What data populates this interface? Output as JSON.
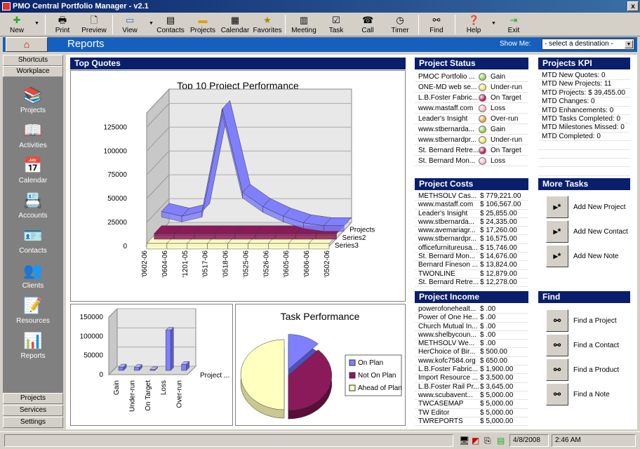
{
  "window": {
    "title": "PMO Central Portfolio Manager - v2.1",
    "close_label": "x"
  },
  "toolbar": [
    {
      "label": "New",
      "icon": "plus-icon"
    },
    {
      "label": "Print",
      "icon": "printer-icon"
    },
    {
      "label": "Preview",
      "icon": "preview-icon"
    },
    {
      "label": "View",
      "icon": "view-icon"
    },
    {
      "label": "Contacts",
      "icon": "contacts-icon"
    },
    {
      "label": "Projects",
      "icon": "folder-icon"
    },
    {
      "label": "Calendar",
      "icon": "calendar-icon"
    },
    {
      "label": "Favorites",
      "icon": "star-icon"
    },
    {
      "label": "Meeting",
      "icon": "meeting-icon"
    },
    {
      "label": "Task",
      "icon": "checkbox-icon"
    },
    {
      "label": "Call",
      "icon": "phone-icon"
    },
    {
      "label": "Timer",
      "icon": "clock-icon"
    },
    {
      "label": "Find",
      "icon": "binoculars-icon"
    },
    {
      "label": "Help",
      "icon": "help-icon"
    },
    {
      "label": "Exit",
      "icon": "exit-icon"
    }
  ],
  "header": {
    "title": "Reports",
    "show_me_label": "Show Me:",
    "destination_value": "- select a destination -"
  },
  "sidebar": {
    "top_tabs": [
      "Shortcuts",
      "Workplace"
    ],
    "items": [
      {
        "label": "Projects",
        "icon": "books-icon"
      },
      {
        "label": "Activities",
        "icon": "activities-icon"
      },
      {
        "label": "Calendar",
        "icon": "calendar-icon"
      },
      {
        "label": "Accounts",
        "icon": "accounts-icon"
      },
      {
        "label": "Contacts",
        "icon": "contact-card-icon"
      },
      {
        "label": "Clients",
        "icon": "clients-icon"
      },
      {
        "label": "Resources",
        "icon": "resources-icon"
      },
      {
        "label": "Reports",
        "icon": "reports-icon"
      }
    ],
    "bottom_tabs": [
      "Projects",
      "Services",
      "Settings"
    ]
  },
  "top_quotes": {
    "title": "Top Quotes"
  },
  "project_status": {
    "title": "Project Status",
    "rows": [
      {
        "name": "PMOC Portfolio ...",
        "status": "Gain",
        "color": "#8fd14f"
      },
      {
        "name": "ONE-MD web se...",
        "status": "Under-run",
        "color": "#f0e060"
      },
      {
        "name": "L.B.Foster Fabric...",
        "status": "On Target",
        "color": "#c0185c"
      },
      {
        "name": "www.mastaff.com",
        "status": "Loss",
        "color": "#f4b8c8"
      },
      {
        "name": "Leader's Insight",
        "status": "Over-run",
        "color": "#f0a040"
      },
      {
        "name": "www.stbernarda...",
        "status": "Gain",
        "color": "#8fd14f"
      },
      {
        "name": "www.stbernardpr...",
        "status": "Under-run",
        "color": "#f0e060"
      },
      {
        "name": "St. Bernard Retre...",
        "status": "On Target",
        "color": "#c0185c"
      },
      {
        "name": "St. Bernard Mon...",
        "status": "Loss",
        "color": "#f4b8c8"
      }
    ]
  },
  "projects_kpi": {
    "title": "Projects KPI",
    "rows": [
      "MTD New Quotes: 0",
      "MTD New Projects: 11",
      "MTD Projects: $ 39,455.00",
      "MTD Changes: 0",
      "MTD Enhancements: 0",
      "MTD Tasks Completed: 0",
      "MTD Milestones Missed: 0",
      "MTD Completed: 0"
    ]
  },
  "project_costs": {
    "title": "Project Costs",
    "rows": [
      {
        "name": "METHSOLV Cas...",
        "amount": "$ 779,221.00"
      },
      {
        "name": "www.mastaff.com",
        "amount": "$ 106,567.00"
      },
      {
        "name": "Leader's Insight",
        "amount": "$ 25,855.00"
      },
      {
        "name": "www.stbernarda...",
        "amount": "$ 24,335.00"
      },
      {
        "name": "www.avemariagr...",
        "amount": "$ 17,260.00"
      },
      {
        "name": "www.stbernardpr...",
        "amount": "$ 16,575.00"
      },
      {
        "name": "officefurnitureusa...",
        "amount": "$ 15,746.00"
      },
      {
        "name": "St. Bernard Mon...",
        "amount": "$ 14,676.00"
      },
      {
        "name": "Bernard Fineson ...",
        "amount": "$ 13,824.00"
      },
      {
        "name": "TWONLINE",
        "amount": "$ 12,879.00"
      },
      {
        "name": "St. Bernard Retre...",
        "amount": "$ 12,278.00"
      }
    ]
  },
  "more_tasks": {
    "title": "More Tasks",
    "items": [
      {
        "label": "Add New Project",
        "icon": "add-icon"
      },
      {
        "label": "Add New Contact",
        "icon": "add-icon"
      },
      {
        "label": "Add New Note",
        "icon": "add-icon"
      }
    ]
  },
  "project_income": {
    "title": "Project Income",
    "rows": [
      {
        "name": "powerofonehealt...",
        "amount": "$ .00"
      },
      {
        "name": "Power of One He...",
        "amount": "$ .00"
      },
      {
        "name": "Church Mutual In...",
        "amount": "$ .00"
      },
      {
        "name": "www.shelbycoun...",
        "amount": "$ .00"
      },
      {
        "name": "METHSOLV We...",
        "amount": "$ .00"
      },
      {
        "name": "HerChoice of Bir...",
        "amount": "$ 500.00"
      },
      {
        "name": "www.kofc7584.org",
        "amount": "$ 650.00"
      },
      {
        "name": "L.B.Foster Fabric...",
        "amount": "$ 1,900.00"
      },
      {
        "name": "Import Resource ...",
        "amount": "$ 3,500.00"
      },
      {
        "name": "L.B.Foster Rail Pr...",
        "amount": "$ 3,645.00"
      },
      {
        "name": "www.scubavent...",
        "amount": "$ 5,000.00"
      },
      {
        "name": "TWCASEMAP",
        "amount": "$ 5,000.00"
      },
      {
        "name": "TW Editor",
        "amount": "$ 5,000.00"
      },
      {
        "name": "TWREPORTS",
        "amount": "$ 5,000.00"
      }
    ]
  },
  "find": {
    "title": "Find",
    "items": [
      {
        "label": "Find a Project",
        "icon": "binoculars-icon"
      },
      {
        "label": "Find a Contact",
        "icon": "binoculars-icon"
      },
      {
        "label": "Find a Product",
        "icon": "binoculars-icon"
      },
      {
        "label": "Find a Note",
        "icon": "binoculars-icon"
      }
    ]
  },
  "status_bar": {
    "date": "4/8/2008",
    "time": "2:46 AM"
  },
  "chart_data": [
    {
      "type": "line",
      "title": "Top 10 Project Performance",
      "categories": [
        "'0602-06",
        "'0604-06",
        "'1201-05",
        "'0517-06",
        "'0518-06",
        "'0525-06",
        "'0526-06",
        "'0605-06",
        "'0606-06",
        "'0502-06"
      ],
      "series": [
        {
          "name": "Projects",
          "values": [
            20000,
            15000,
            20000,
            128000,
            40000,
            25000,
            15000,
            8000,
            5000,
            5000
          ],
          "color": "#8080ff"
        },
        {
          "name": "Series2",
          "values": [
            5000,
            5000,
            5000,
            5000,
            5000,
            5000,
            5000,
            5000,
            5000,
            5000
          ],
          "color": "#8b1a5a"
        },
        {
          "name": "Series3",
          "values": [
            3000,
            3000,
            3000,
            3000,
            3000,
            3000,
            3000,
            3000,
            3000,
            3000
          ],
          "color": "#ffffc0"
        }
      ],
      "yticks": [
        0,
        25000,
        50000,
        75000,
        100000,
        125000
      ],
      "ylim": [
        0,
        140000
      ]
    },
    {
      "type": "bar",
      "categories": [
        "Gain",
        "Under-run",
        "On Target",
        "Loss",
        "Over-run"
      ],
      "series": [
        {
          "name": "Project ...",
          "values": [
            9000,
            8000,
            2000,
            105000,
            16000
          ],
          "color": "#8080ff"
        }
      ],
      "yticks": [
        0,
        50000,
        100000,
        150000
      ],
      "ylim": [
        0,
        150000
      ]
    },
    {
      "type": "pie",
      "title": "Task Performance",
      "slices": [
        {
          "label": "On Plan",
          "value": 12,
          "color": "#8080ff"
        },
        {
          "label": "Not On Plan",
          "value": 38,
          "color": "#8b1a5a"
        },
        {
          "label": "Ahead of Plan",
          "value": 50,
          "color": "#ffffc0"
        }
      ],
      "legend": "right"
    }
  ]
}
